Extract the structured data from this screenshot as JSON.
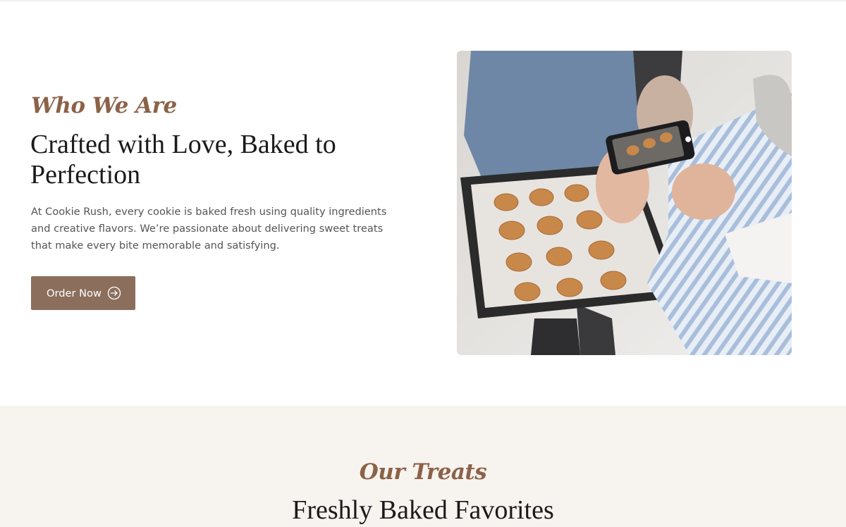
{
  "about": {
    "eyebrow": "Who We Are",
    "heading": "Crafted with Love, Baked to Perfection",
    "body": "At Cookie Rush, every cookie is baked fresh using quality ingredients and creative flavors. We’re passionate about delivering sweet treats that make every bite memorable and satisfying.",
    "cta_label": "Order Now",
    "cta_icon": "arrow-circle-right-icon"
  },
  "treats": {
    "eyebrow": "Our Treats",
    "heading": "Freshly Baked Favorites"
  },
  "colors": {
    "accent": "#8b6248",
    "button": "#8c6e5d",
    "section_bg": "#f7f3ef",
    "heading": "#1a1a1a",
    "body_text": "#555555"
  }
}
